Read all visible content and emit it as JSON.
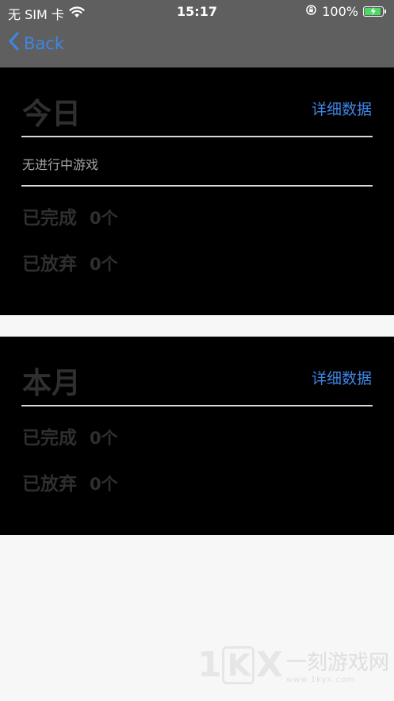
{
  "status_bar": {
    "carrier": "无 SIM 卡",
    "time": "15:17",
    "battery_percent": "100%",
    "battery_level": 1.0,
    "battery_color": "#4cd964"
  },
  "nav": {
    "back_label": "Back",
    "accent_color": "#3f86e6"
  },
  "today": {
    "title": "今日",
    "detail_link": "详细数据",
    "no_game_text": "无进行中游戏",
    "completed_label": "已完成",
    "completed_value": "0个",
    "abandoned_label": "已放弃",
    "abandoned_value": "0个"
  },
  "month": {
    "title": "本月",
    "detail_link": "详细数据",
    "completed_label": "已完成",
    "completed_value": "0个",
    "abandoned_label": "已放弃",
    "abandoned_value": "0个"
  },
  "watermark": {
    "logo_icon": "1kyx-logo-icon",
    "site_name": "一刻游戏网",
    "url": "www.1kyx.com"
  }
}
